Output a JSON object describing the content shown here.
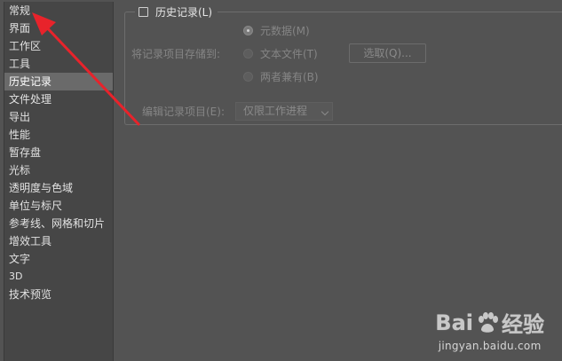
{
  "sidebar": {
    "items": [
      {
        "label": "常规"
      },
      {
        "label": "界面"
      },
      {
        "label": "工作区"
      },
      {
        "label": "工具"
      },
      {
        "label": "历史记录"
      },
      {
        "label": "文件处理"
      },
      {
        "label": "导出"
      },
      {
        "label": "性能"
      },
      {
        "label": "暂存盘"
      },
      {
        "label": "光标"
      },
      {
        "label": "透明度与色域"
      },
      {
        "label": "单位与标尺"
      },
      {
        "label": "参考线、网格和切片"
      },
      {
        "label": "增效工具"
      },
      {
        "label": "文字"
      },
      {
        "label": "3D"
      },
      {
        "label": "技术预览"
      }
    ],
    "active_index": 4
  },
  "history": {
    "title": "历史记录(L)",
    "checked": false,
    "save_to_label": "将记录项目存储到:",
    "options": [
      {
        "label": "元数据(M)",
        "selected": true
      },
      {
        "label": "文本文件(T)",
        "selected": false
      },
      {
        "label": "两者兼有(B)",
        "selected": false
      }
    ],
    "choose_button": "选取(Q)...",
    "edit_log_label": "编辑记录项目(E):",
    "edit_log_value": "仅限工作进程"
  },
  "watermark": {
    "logo_left": "Bai",
    "logo_right": "经验",
    "url": "jingyan.baidu.com"
  },
  "colors": {
    "background": "#535353",
    "sidebar": "#464646",
    "active_item": "#6a6a6a",
    "annotation_arrow": "#e8232b"
  }
}
